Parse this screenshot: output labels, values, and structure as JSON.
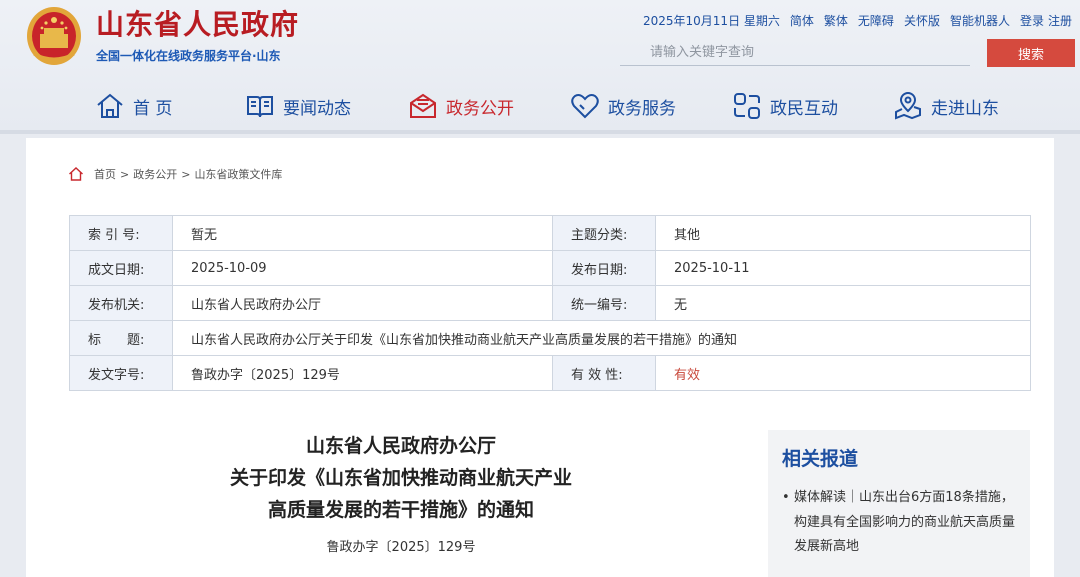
{
  "header": {
    "site_title": "山东省人民政府",
    "site_subtitle": "全国一体化在线政务服务平台·山东",
    "top_links": {
      "date": "2025年10月11日 星期六",
      "simplified": "简体",
      "traditional": "繁体",
      "accessibility": "无障碍",
      "elderly": "关怀版",
      "robot": "智能机器人",
      "login": "登录",
      "register": "注册"
    },
    "search": {
      "placeholder": "请输入关键字查询",
      "button_label": "搜索"
    }
  },
  "nav": {
    "items": [
      {
        "label": "首 页",
        "icon": "home-icon"
      },
      {
        "label": "要闻动态",
        "icon": "book-icon"
      },
      {
        "label": "政务公开",
        "icon": "envelope-icon",
        "active": true
      },
      {
        "label": "政务服务",
        "icon": "heart-icon"
      },
      {
        "label": "政民互动",
        "icon": "interaction-icon"
      },
      {
        "label": "走进山东",
        "icon": "map-pin-icon"
      }
    ]
  },
  "breadcrumb": {
    "items": [
      "首页",
      "政务公开",
      "山东省政策文件库"
    ],
    "separator": ">"
  },
  "meta": {
    "index_label": "索 引 号:",
    "index_value": "暂无",
    "topic_label": "主题分类:",
    "topic_value": "其他",
    "created_label": "成文日期:",
    "created_value": "2025-10-09",
    "published_label": "发布日期:",
    "published_value": "2025-10-11",
    "issuer_label": "发布机关:",
    "issuer_value": "山东省人民政府办公厅",
    "unified_label": "统一编号:",
    "unified_value": "无",
    "title_label": "标　　题:",
    "title_value": "山东省人民政府办公厅关于印发《山东省加快推动商业航天产业高质量发展的若干措施》的通知",
    "docno_label": "发文字号:",
    "docno_value": "鲁政办字〔2025〕129号",
    "validity_label": "有 效 性:",
    "validity_value": "有效"
  },
  "document": {
    "title_line1": "山东省人民政府办公厅",
    "title_line2": "关于印发《山东省加快推动商业航天产业",
    "title_line3": "高质量发展的若干措施》的通知",
    "number": "鲁政办字〔2025〕129号"
  },
  "related": {
    "title": "相关报道",
    "items": [
      "媒体解读｜山东出台6方面18条措施，构建具有全国影响力的商业航天高质量发展新高地"
    ]
  },
  "colors": {
    "brand_red": "#b81c22",
    "nav_blue": "#1d4fa0",
    "active_red": "#c8282e",
    "search_button": "#d54a3e",
    "validity_red": "#c94a3c"
  }
}
